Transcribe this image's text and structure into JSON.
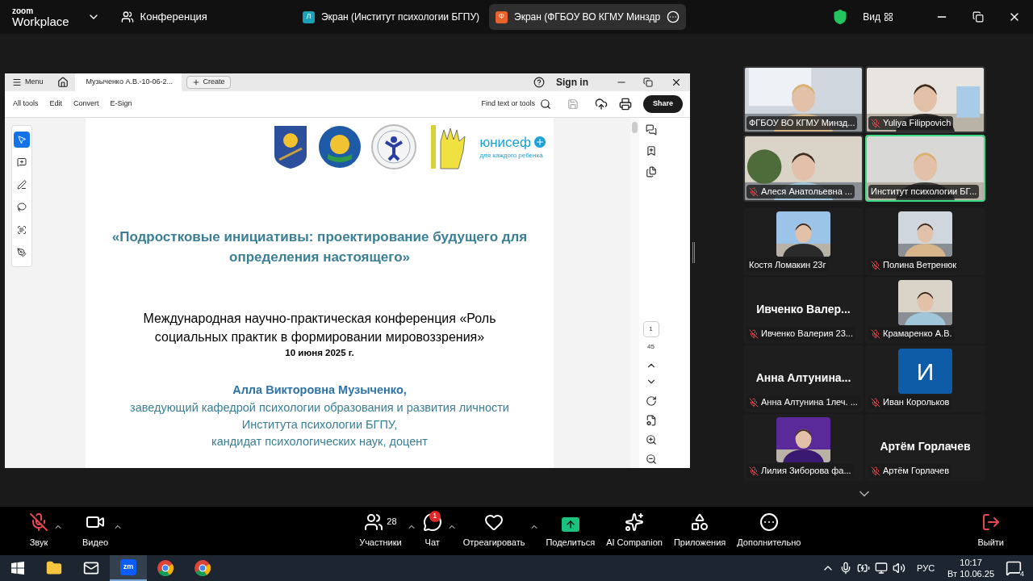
{
  "title_bar": {
    "logo_top": "zoom",
    "logo_bottom": "Workplace",
    "meeting": "Конференция",
    "share_tabs": [
      {
        "avatar": "Л",
        "color": "#1aa3b8",
        "label": "Экран (Институт психологии БГПУ)",
        "selected": false
      },
      {
        "avatar": "Ф",
        "color": "#e8622c",
        "label": "Экран (ФГБОУ ВО КГМУ Минздр",
        "selected": true
      }
    ],
    "view": "Вид"
  },
  "shared_window": {
    "menu": "Menu",
    "tab_title": "Музыченко А.В.-10-06-2...",
    "create": "Create",
    "sign_in": "Sign in",
    "menus": [
      "All tools",
      "Edit",
      "Convert",
      "E-Sign"
    ],
    "find": "Find text or tools",
    "share": "Share",
    "tools": [
      {
        "kind": "select",
        "selected": true
      },
      {
        "kind": "comment",
        "selected": false
      },
      {
        "kind": "draw",
        "selected": false
      },
      {
        "kind": "lasso",
        "selected": false
      },
      {
        "kind": "ocr",
        "selected": false
      },
      {
        "kind": "sign",
        "selected": false
      }
    ],
    "unicef": "юнисеф",
    "unicef_tagline": "для каждого ребенка",
    "slide": {
      "title": "«Подростковые инициативы: проектирование будущего для определения настоящего»",
      "conference": "Международная научно-практическая конференция «Роль социальных практик в формировании мировоззрения»",
      "date": "10 июня 2025 г.",
      "speaker": "Алла Викторовна Музыченко,",
      "position_lines": [
        "заведующий кафедрой психологии образования и развития личности",
        "Института психологии БГПУ,",
        "кандидат психологических наук, доцент"
      ]
    },
    "page_number": "1",
    "page_count": "45"
  },
  "gallery": [
    {
      "kind": "video",
      "name": "ФГБОУ ВО КГМУ Минзд...",
      "muted": false,
      "active": false
    },
    {
      "kind": "video",
      "name": "Yuliya Filippovich",
      "muted": true,
      "active": false
    },
    {
      "kind": "video",
      "name": "Алеся Анатольевна ...",
      "muted": true,
      "active": false
    },
    {
      "kind": "video",
      "name": "Институт психологии БГ...",
      "muted": false,
      "active": true
    },
    {
      "name": "Костя Ломакин 23г",
      "muted": false,
      "active": false
    },
    {
      "name": "Полина Ветренюк",
      "muted": true,
      "active": false
    },
    {
      "kind": "name",
      "display": "Ивченко  Валер...",
      "name": "Ивченко Валерия 23...",
      "muted": true,
      "active": false
    },
    {
      "name": "Крамаренко А.В.",
      "muted": true,
      "active": false
    },
    {
      "kind": "name",
      "display": "Анна  Алтунина...",
      "name": "Анна Алтунина 1леч. ...",
      "muted": true,
      "active": false
    },
    {
      "kind": "avatar",
      "initial": "И",
      "name": "Иван Корольков",
      "muted": true,
      "active": false
    },
    {
      "name": "Лилия Зиборова фа...",
      "muted": true,
      "active": false
    },
    {
      "kind": "name",
      "display": "Артём Горлачев",
      "name": "Артём Горлачев",
      "muted": true,
      "active": false
    }
  ],
  "toolbar": [
    {
      "kind": "audio",
      "label": "Звук",
      "muted": true,
      "caret": true
    },
    {
      "kind": "video",
      "label": "Видео",
      "caret": true
    },
    {
      "kind": "participants",
      "label": "Участники",
      "count": "28",
      "caret": true
    },
    {
      "kind": "chat",
      "label": "Чат",
      "badge": "1",
      "caret": true
    },
    {
      "kind": "react",
      "label": "Отреагировать",
      "caret": true
    },
    {
      "kind": "share",
      "label": "Поделиться",
      "caret": false
    },
    {
      "kind": "ai",
      "label": "AI Companion",
      "caret": false
    },
    {
      "kind": "apps",
      "label": "Приложения",
      "caret": false
    },
    {
      "kind": "more",
      "label": "Дополнительно",
      "caret": false
    },
    {
      "kind": "leave",
      "label": "Выйти",
      "caret": false
    }
  ],
  "taskbar": {
    "apps": [
      {
        "kind": "files",
        "selected": false
      },
      {
        "kind": "mail",
        "selected": false
      },
      {
        "kind": "zoom",
        "label": "zm",
        "selected": true
      },
      {
        "kind": "chrome",
        "selected": false
      },
      {
        "kind": "chrome",
        "selected": false
      }
    ],
    "language": "РУС",
    "time": "10:17",
    "date": "Вт 10.06.25",
    "notifications": "4"
  }
}
